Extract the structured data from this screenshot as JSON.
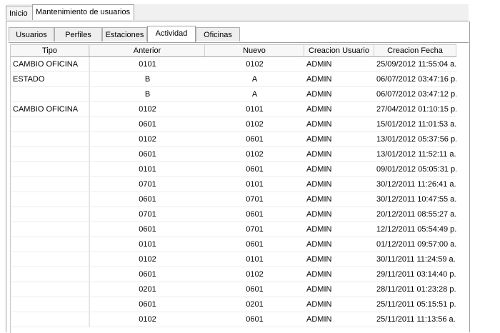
{
  "top_tabs": [
    {
      "label": "Inicio"
    },
    {
      "label": "Mantenimiento de usuarios"
    }
  ],
  "sub_tabs": [
    {
      "label": "Usuarios"
    },
    {
      "label": "Perfiles"
    },
    {
      "label": "Estaciones"
    },
    {
      "label": "Actividad"
    },
    {
      "label": "Oficinas"
    }
  ],
  "table": {
    "headers": [
      "Tipo",
      "Anterior",
      "Nuevo",
      "Creacion Usuario",
      "Creacion Fecha"
    ],
    "rows": [
      [
        "CAMBIO OFICINA",
        "0101",
        "0102",
        "ADMIN",
        "25/09/2012 11:55:04 a."
      ],
      [
        "ESTADO",
        "B",
        "A",
        "ADMIN",
        "06/07/2012 03:47:16 p."
      ],
      [
        "",
        "B",
        "A",
        "ADMIN",
        "06/07/2012 03:47:12 p."
      ],
      [
        "CAMBIO OFICINA",
        "0102",
        "0101",
        "ADMIN",
        "27/04/2012 01:10:15 p."
      ],
      [
        "",
        "0601",
        "0102",
        "ADMIN",
        "15/01/2012 11:01:53 a."
      ],
      [
        "",
        "0102",
        "0601",
        "ADMIN",
        "13/01/2012 05:37:56 p."
      ],
      [
        "",
        "0601",
        "0102",
        "ADMIN",
        "13/01/2012 11:52:11 a."
      ],
      [
        "",
        "0101",
        "0601",
        "ADMIN",
        "09/01/2012 05:05:31 p."
      ],
      [
        "",
        "0701",
        "0101",
        "ADMIN",
        "30/12/2011 11:26:41 a."
      ],
      [
        "",
        "0601",
        "0701",
        "ADMIN",
        "30/12/2011 10:47:55 a."
      ],
      [
        "",
        "0701",
        "0601",
        "ADMIN",
        "20/12/2011 08:55:27 a."
      ],
      [
        "",
        "0601",
        "0701",
        "ADMIN",
        "12/12/2011 05:54:49 p."
      ],
      [
        "",
        "0101",
        "0601",
        "ADMIN",
        "01/12/2011 09:57:00 a."
      ],
      [
        "",
        "0102",
        "0101",
        "ADMIN",
        "30/11/2011 11:24:59 a."
      ],
      [
        "",
        "0601",
        "0102",
        "ADMIN",
        "29/11/2011 03:14:40 p."
      ],
      [
        "",
        "0201",
        "0601",
        "ADMIN",
        "28/11/2011 01:23:28 p."
      ],
      [
        "",
        "0601",
        "0201",
        "ADMIN",
        "25/11/2011 05:15:51 p."
      ],
      [
        "",
        "0102",
        "0601",
        "ADMIN",
        "25/11/2011 11:13:56 a."
      ]
    ]
  }
}
